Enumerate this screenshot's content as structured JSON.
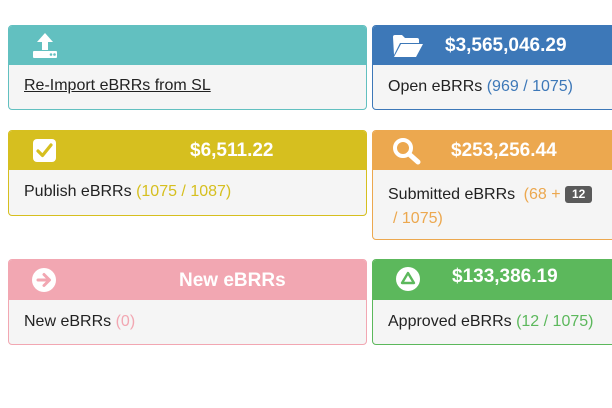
{
  "colors": {
    "teal": "#62c0c0",
    "blue": "#3d78b8",
    "olive": "#d6bf1f",
    "orange": "#eca84f",
    "pink": "#f2a7b2",
    "green": "#5cb85c"
  },
  "cards": {
    "reimport": {
      "icon": "upload-icon",
      "label": "Re-Import eBRRs from SL"
    },
    "open": {
      "icon": "folder-open-icon",
      "amount": "$3,565,046.29",
      "label": "Open eBRRs",
      "count": "(969 / 1075)"
    },
    "publish": {
      "icon": "checkbox-icon",
      "amount": "$6,511.22",
      "label": "Publish eBRRs",
      "count": "(1075 / 1087)"
    },
    "submitted": {
      "icon": "search-icon",
      "amount": "$253,256.44",
      "label": "Submitted eBRRs",
      "count_start": "(68 +",
      "badge": "12",
      "count_end": "/ 1075)"
    },
    "new": {
      "icon": "arrow-right-circle-icon",
      "title": "New eBRRs",
      "label": "New eBRRs",
      "count": "(0)"
    },
    "approved": {
      "icon": "triangle-circle-icon",
      "amount": "$133,386.19",
      "label": "Approved eBRRs",
      "count": "(12 / 1075)"
    }
  }
}
